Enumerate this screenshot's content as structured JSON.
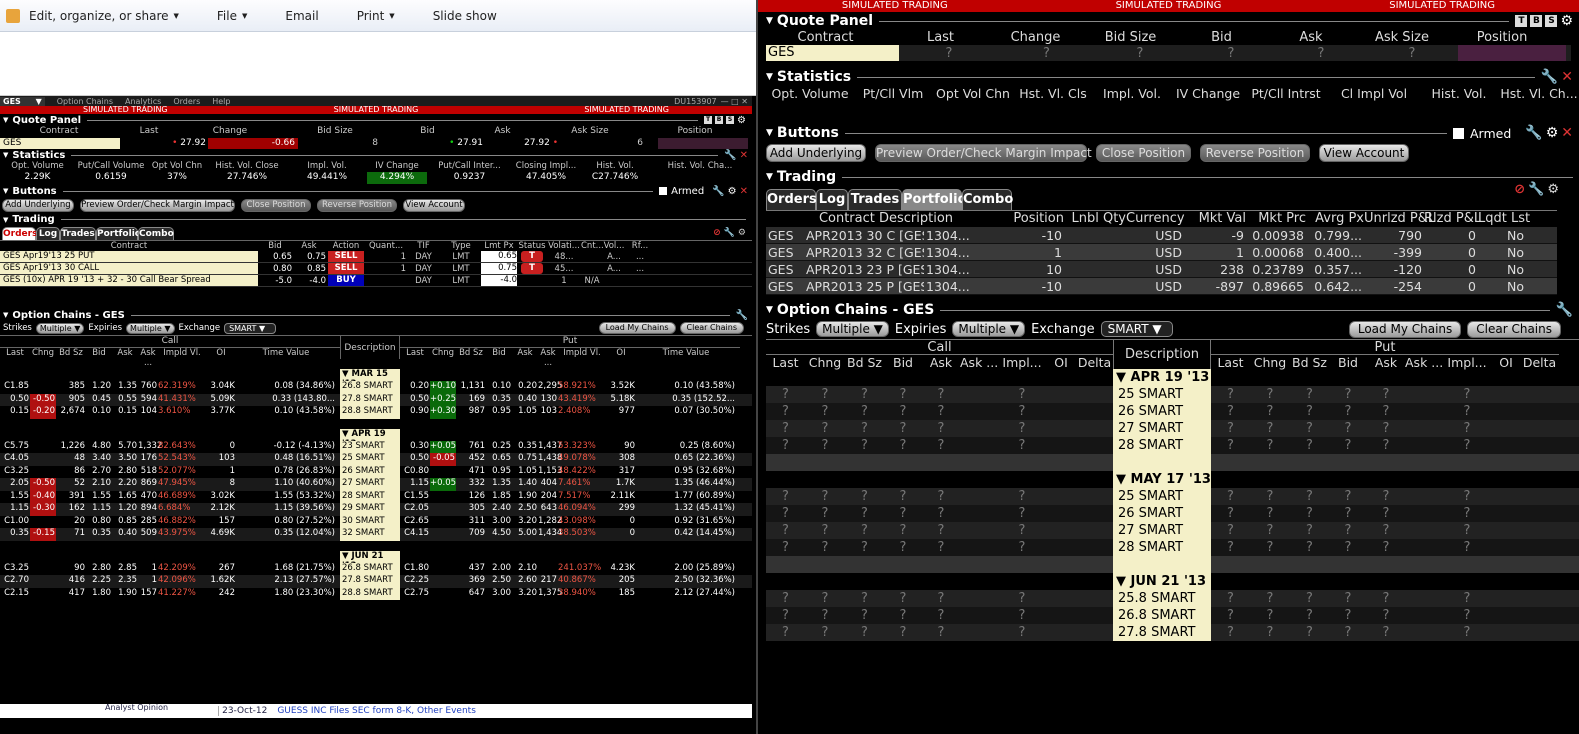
{
  "photoviewer": {
    "edit": "Edit, organize, or share",
    "file": "File",
    "email": "Email",
    "print": "Print",
    "slideshow": "Slide show"
  },
  "left": {
    "menu": {
      "symbol": "GES",
      "items": [
        "Option Chains",
        "Analytics",
        "Orders",
        "Help"
      ],
      "account": "DU153907"
    },
    "sim": "SIMULATED TRADING",
    "quote": {
      "title": "Quote Panel",
      "headers": [
        "Contract",
        "Last",
        "Change",
        "Bid Size",
        "Bid",
        "Ask",
        "Ask Size",
        "Position"
      ],
      "contract": "GES",
      "last": "27.92",
      "change": "-0.66",
      "bidsize": "8",
      "bid": "27.91",
      "ask": "27.92",
      "asksize": "6"
    },
    "stats": {
      "title": "Statistics",
      "headers": [
        "Opt. Volume",
        "Put/Call Volume",
        "Opt Vol Chn",
        "Hist. Vol. Close",
        "Impl. Vol.",
        "IV Change",
        "Put/Call Inter...",
        "Closing Impl...",
        "Hist. Vol.",
        "Hist. Vol. Cha..."
      ],
      "values": [
        "2.29K",
        "0.6159",
        "37%",
        "27.746%",
        "49.441%",
        "4.294%",
        "0.9237",
        "47.405%",
        "C27.746%",
        ""
      ]
    },
    "buttons": {
      "title": "Buttons",
      "armed": "Armed",
      "items": [
        "Add Underlying",
        "Preview Order/Check Margin Impact",
        "Close Position",
        "Reverse Position",
        "View Account"
      ]
    },
    "trading": {
      "title": "Trading",
      "tabs": [
        "Orders",
        "Log",
        "Trades",
        "Portfolio",
        "Combo"
      ],
      "headers": [
        "Contract",
        "Bid",
        "Ask",
        "Action",
        "Quant...",
        "TIF",
        "Type",
        "Lmt Px",
        "Status",
        "Volati...",
        "Cnt...",
        "Vol...",
        "Rf..."
      ],
      "rows": [
        {
          "contract": "GES Apr19'13 25 PUT",
          "bid": "0.65",
          "ask": "0.75",
          "action": "SELL",
          "qty": "1",
          "tif": "DAY",
          "type": "LMT",
          "lmt": "0.65",
          "status": "T",
          "vol": "48...",
          "cnt": "",
          "v2": "A...",
          "rf": "..."
        },
        {
          "contract": "GES Apr19'13 30 CALL",
          "bid": "0.80",
          "ask": "0.85",
          "action": "SELL",
          "qty": "1",
          "tif": "DAY",
          "type": "LMT",
          "lmt": "0.75",
          "status": "T",
          "vol": "45...",
          "cnt": "",
          "v2": "A...",
          "rf": "..."
        },
        {
          "contract": "GES (10x) APR 19 '13 + 32 - 30 Call Bear Spread",
          "bid": "-5.0",
          "ask": "-4.0",
          "action": "BUY",
          "qty": "",
          "tif": "DAY",
          "type": "LMT",
          "lmt": "-4.0",
          "status": "",
          "vol": "1",
          "cnt": "N/A",
          "v2": "",
          "rf": ""
        }
      ]
    },
    "chains": {
      "title": "Option Chains - GES",
      "strikes": "Strikes",
      "multiple": "Multiple",
      "expiries": "Expiries",
      "exchange": "Exchange",
      "smart": "SMART",
      "load": "Load My Chains",
      "clear": "Clear Chains",
      "call": "Call",
      "put": "Put",
      "desc": "Description",
      "callh": [
        "Last",
        "Chng",
        "Bd Sz",
        "Bid",
        "Ask",
        "Ask ...",
        "Impld Vl.",
        "OI",
        "Time Value"
      ],
      "puth": [
        "Last",
        "Chng",
        "Bd Sz",
        "Bid",
        "Ask",
        "Ask ...",
        "Impld Vl.",
        "OI",
        "Time Value"
      ],
      "groups": [
        {
          "exp": "MAR 15 '13",
          "rows": [
            {
              "c": [
                "C1.85",
                "",
                "385",
                "1.20",
                "1.35",
                "760",
                "62.319%",
                "3.04K",
                "0.08 (34.86%)"
              ],
              "d": "26.8 SMART",
              "p": [
                "0.20",
                "+0.10",
                "1,131",
                "0.10",
                "0.20",
                "2,295",
                "58.921%",
                "3.52K",
                "0.10 (43.58%)"
              ]
            },
            {
              "c": [
                "0.50",
                "-0.50",
                "905",
                "0.45",
                "0.55",
                "594",
                "41.431%",
                "5.09K",
                "0.33 (143.80..."
              ],
              "d": "27.8 SMART",
              "p": [
                "0.50",
                "+0.25",
                "169",
                "0.35",
                "0.40",
                "130",
                "43.419%",
                "5.18K",
                "0.35 (152.52..."
              ]
            },
            {
              "c": [
                "0.15",
                "-0.20",
                "2,674",
                "0.10",
                "0.15",
                "104",
                "3.610%",
                "3.77K",
                "0.10 (43.58%)"
              ],
              "d": "28.8 SMART",
              "p": [
                "0.90",
                "+0.30",
                "987",
                "0.95",
                "1.05",
                "103",
                "2.408%",
                "977",
                "0.07 (30.50%)"
              ]
            }
          ]
        },
        {
          "exp": "APR 19 '13",
          "rows": [
            {
              "c": [
                "C5.75",
                "",
                "1,226",
                "4.80",
                "5.70",
                "1,332",
                "82.643%",
                "0",
                "-0.12 (-4.13%)"
              ],
              "d": "23 SMART",
              "p": [
                "0.30",
                "+0.05",
                "761",
                "0.25",
                "0.35",
                "1,437",
                "53.323%",
                "90",
                "0.25 (8.60%)"
              ]
            },
            {
              "c": [
                "C4.05",
                "",
                "48",
                "3.40",
                "3.50",
                "176",
                "52.543%",
                "103",
                "0.48 (16.51%)"
              ],
              "d": "25 SMART",
              "p": [
                "0.50",
                "-0.05",
                "452",
                "0.65",
                "0.75",
                "1,438",
                "49.078%",
                "308",
                "0.65 (22.36%)"
              ]
            },
            {
              "c": [
                "C3.25",
                "",
                "86",
                "2.70",
                "2.80",
                "518",
                "52.077%",
                "1",
                "0.78 (26.83%)"
              ],
              "d": "26 SMART",
              "p": [
                "C0.80",
                "",
                "471",
                "0.95",
                "1.05",
                "1,153",
                "48.422%",
                "317",
                "0.95 (32.68%)"
              ]
            },
            {
              "c": [
                "2.05",
                "-0.50",
                "52",
                "2.10",
                "2.20",
                "869",
                "47.945%",
                "8",
                "1.10 (40.60%)"
              ],
              "d": "27 SMART",
              "p": [
                "1.15",
                "+0.05",
                "332",
                "1.35",
                "1.40",
                "404",
                "7.461%",
                "1.7K",
                "1.35 (46.44%)"
              ]
            },
            {
              "c": [
                "1.55",
                "-0.40",
                "391",
                "1.55",
                "1.65",
                "470",
                "46.689%",
                "3.02K",
                "1.55 (53.32%)"
              ],
              "d": "28 SMART",
              "p": [
                "C1.55",
                "",
                "126",
                "1.85",
                "1.90",
                "204",
                "7.517%",
                "2.11K",
                "1.77 (60.89%)"
              ]
            },
            {
              "c": [
                "1.15",
                "-0.30",
                "162",
                "1.15",
                "1.20",
                "894",
                "6.684%",
                "2.12K",
                "1.15 (39.56%)"
              ],
              "d": "29 SMART",
              "p": [
                "C2.05",
                "",
                "305",
                "2.40",
                "2.50",
                "643",
                "46.094%",
                "299",
                "1.32 (45.41%)"
              ]
            },
            {
              "c": [
                "C1.00",
                "",
                "20",
                "0.80",
                "0.85",
                "285",
                "46.882%",
                "157",
                "0.80 (27.52%)"
              ],
              "d": "30 SMART",
              "p": [
                "C2.65",
                "",
                "311",
                "3.00",
                "3.20",
                "1,282",
                "43.098%",
                "0",
                "0.92 (31.65%)"
              ]
            },
            {
              "c": [
                "0.35",
                "-0.15",
                "71",
                "0.35",
                "0.40",
                "509",
                "43.975%",
                "4.69K",
                "0.35 (12.04%)"
              ],
              "d": "32 SMART",
              "p": [
                "C4.15",
                "",
                "709",
                "4.50",
                "5.00",
                "1,434",
                "38.503%",
                "0",
                "0.42 (14.45%)"
              ]
            }
          ]
        },
        {
          "exp": "JUN 21 '13",
          "rows": [
            {
              "c": [
                "C3.25",
                "",
                "90",
                "2.80",
                "2.85",
                "1",
                "42.209%",
                "267",
                "1.68 (21.75%)"
              ],
              "d": "26.8 SMART",
              "p": [
                "C1.80",
                "",
                "437",
                "2.00",
                "2.10",
                "",
                "241.037%",
                "4.23K",
                "2.00 (25.89%)"
              ]
            },
            {
              "c": [
                "C2.70",
                "",
                "416",
                "2.25",
                "2.35",
                "1",
                "42.096%",
                "1.62K",
                "2.13 (27.57%)"
              ],
              "d": "27.8 SMART",
              "p": [
                "C2.25",
                "",
                "369",
                "2.50",
                "2.60",
                "217",
                "40.867%",
                "205",
                "2.50 (32.36%)"
              ]
            },
            {
              "c": [
                "C2.15",
                "",
                "417",
                "1.80",
                "1.90",
                "157",
                "41.227%",
                "242",
                "1.80 (23.30%)"
              ],
              "d": "28.8 SMART",
              "p": [
                "C2.75",
                "",
                "647",
                "3.00",
                "3.20",
                "1,375",
                "38.940%",
                "185",
                "2.12 (27.44%)"
              ]
            }
          ]
        }
      ]
    },
    "status": {
      "date": "23-Oct-12",
      "news": "GUESS INC Files SEC form 8-K, Other Events",
      "label": "Analyst Opinion"
    }
  },
  "right": {
    "sim": "SIMULATED TRADING",
    "quote": {
      "title": "Quote Panel",
      "headers": [
        "Contract",
        "Last",
        "Change",
        "Bid Size",
        "Bid",
        "Ask",
        "Ask Size",
        "Position"
      ],
      "contract": "GES"
    },
    "stats": {
      "title": "Statistics",
      "headers": [
        "Opt. Volume",
        "Pt/Cll Vlm",
        "Opt Vol Chn",
        "Hst. Vl. Cls",
        "Impl. Vol.",
        "IV Change",
        "Pt/Cll Intrst",
        "Cl Impl Vol",
        "Hist. Vol.",
        "Hst. Vl. Ch..."
      ]
    },
    "buttons": {
      "title": "Buttons",
      "armed": "Armed",
      "items": [
        "Add Underlying",
        "Preview Order/Check Margin Impact",
        "Close Position",
        "Reverse Position",
        "View Account"
      ]
    },
    "trading": {
      "title": "Trading",
      "tabs": [
        "Orders",
        "Log",
        "Trades",
        "Portfolio",
        "Combo"
      ],
      "headers": [
        "Contract Description",
        "Position",
        "Lnbl Qty",
        "Currency",
        "Mkt Val",
        "Mkt Prc",
        "Avrg Px",
        "Unrlzd P&L",
        "Rlzd P&L",
        "Lqdt Lst"
      ],
      "rows": [
        [
          "GES",
          "APR2013 30 C [GES",
          "1304...",
          "-10",
          "",
          "USD",
          "-9",
          "0.00938",
          "0.799...",
          "790",
          "0",
          "No"
        ],
        [
          "GES",
          "APR2013 32 C [GES",
          "1304...",
          "1",
          "",
          "USD",
          "1",
          "0.00068",
          "0.400...",
          "-399",
          "0",
          "No"
        ],
        [
          "GES",
          "APR2013 23 P [GES",
          "1304...",
          "10",
          "",
          "USD",
          "238",
          "0.23789",
          "0.357...",
          "-120",
          "0",
          "No"
        ],
        [
          "GES",
          "APR2013 25 P [GES",
          "1304...",
          "-10",
          "",
          "USD",
          "-897",
          "0.89665",
          "0.642...",
          "-254",
          "0",
          "No"
        ]
      ]
    },
    "chains": {
      "title": "Option Chains - GES",
      "strikes": "Strikes",
      "multiple": "Multiple",
      "expiries": "Expiries",
      "exchange": "Exchange",
      "smart": "SMART",
      "load": "Load My Chains",
      "clear": "Clear Chains",
      "call": "Call",
      "put": "Put",
      "desc": "Description",
      "headers": [
        "Last",
        "Chng",
        "Bd Sz",
        "Bid",
        "Ask",
        "Ask ...",
        "Impl...",
        "OI",
        "Delta"
      ],
      "groups": [
        {
          "exp": "APR 19 '13",
          "rows": [
            "25 SMART",
            "26 SMART",
            "27 SMART",
            "28 SMART"
          ]
        },
        {
          "exp": "MAY 17 '13",
          "rows": [
            "25 SMART",
            "26 SMART",
            "27 SMART",
            "28 SMART"
          ]
        },
        {
          "exp": "JUN 21 '13",
          "rows": [
            "25.8 SMART",
            "26.8 SMART",
            "27.8 SMART"
          ]
        }
      ]
    }
  }
}
